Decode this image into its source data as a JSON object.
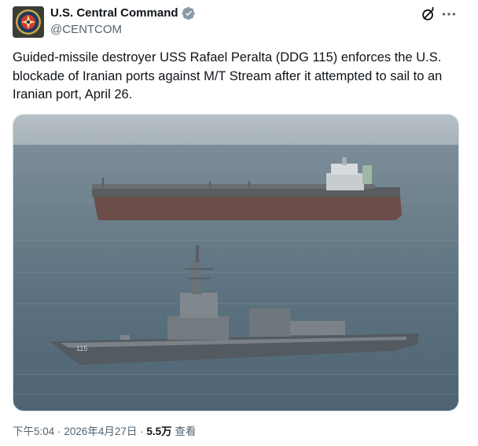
{
  "author": {
    "display_name": "U.S. Central Command",
    "handle": "@CENTCOM",
    "verified": true,
    "avatar_icon": "centcom-seal-icon"
  },
  "header_actions": {
    "grok_icon": "grok-icon",
    "more_icon": "more-icon"
  },
  "post": {
    "text": "Guided-missile destroyer USS Rafael Peralta (DDG 115) enforces the U.S. blockade of Iranian ports against M/T Stream after it attempted to sail to an Iranian port, April 26.",
    "image": {
      "hull_number": "115"
    }
  },
  "meta": {
    "time": "下午5:04",
    "separator": " · ",
    "date": "2026年4月27日",
    "views_count": "5.5万",
    "views_label": "查看"
  },
  "colors": {
    "text_primary": "#0f1419",
    "text_secondary": "#536471",
    "verified_blue": "#1d9bf0",
    "border": "#cfd9de"
  }
}
